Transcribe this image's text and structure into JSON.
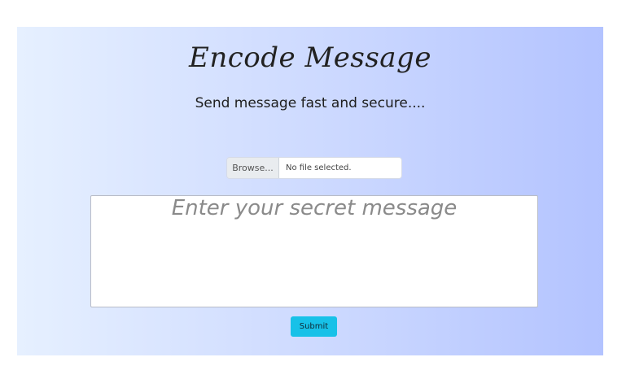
{
  "header": {
    "title": "Encode Message",
    "subtitle": "Send message fast and secure...."
  },
  "file_input": {
    "browse_label": "Browse...",
    "status": "No file selected."
  },
  "message": {
    "placeholder": "Enter your secret message",
    "value": ""
  },
  "actions": {
    "submit_label": "Submit"
  },
  "colors": {
    "accent": "#17c1e8",
    "gradient_start": "#e6f0ff",
    "gradient_end": "#b3c3ff"
  }
}
